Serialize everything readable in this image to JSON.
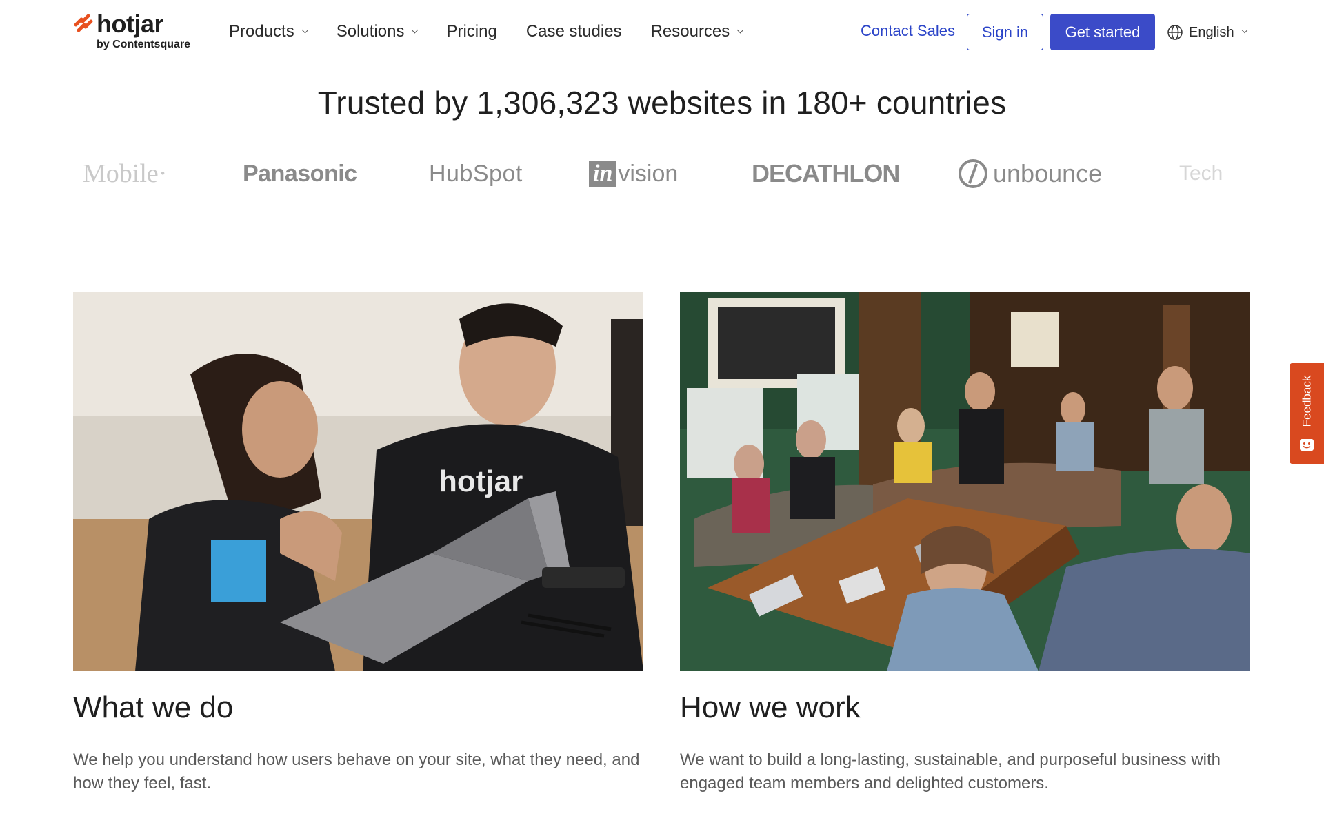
{
  "header": {
    "logo": {
      "word": "hotjar",
      "sub": "by Contentsquare"
    },
    "nav": [
      {
        "label": "Products",
        "dropdown": true
      },
      {
        "label": "Solutions",
        "dropdown": true
      },
      {
        "label": "Pricing",
        "dropdown": false
      },
      {
        "label": "Case studies",
        "dropdown": false
      },
      {
        "label": "Resources",
        "dropdown": true
      }
    ],
    "contact_sales": "Contact Sales",
    "sign_in": "Sign in",
    "get_started": "Get started",
    "language": {
      "label": "English",
      "icon": "globe-icon"
    }
  },
  "trusted": {
    "heading": "Trusted by 1,306,323 websites in 180+ countries",
    "logos": {
      "tmobile": "Mobile·",
      "panasonic": "Panasonic",
      "hubspot": "HubSpot",
      "invision_in": "in",
      "invision_rest": "vision",
      "decathlon": "DECATHLON",
      "unbounce": "unbounce",
      "tech": "Tech"
    }
  },
  "cards": [
    {
      "title": "What we do",
      "text": "We help you understand how users behave on your site, what they need, and how they feel, fast.",
      "image": "photo-team-at-laptop"
    },
    {
      "title": "How we work",
      "text": "We want to build a long-lasting, sustainable, and purposeful business with engaged team members and delighted customers.",
      "image": "photo-team-meeting-lounge"
    }
  ],
  "feedback": {
    "label": "Feedback",
    "icon": "feedback-face-icon"
  },
  "colors": {
    "brand_orange": "#d9491f",
    "primary_blue": "#3b4bc8",
    "link_blue": "#2b44c8",
    "logo_gray": "#8a8a8a"
  }
}
